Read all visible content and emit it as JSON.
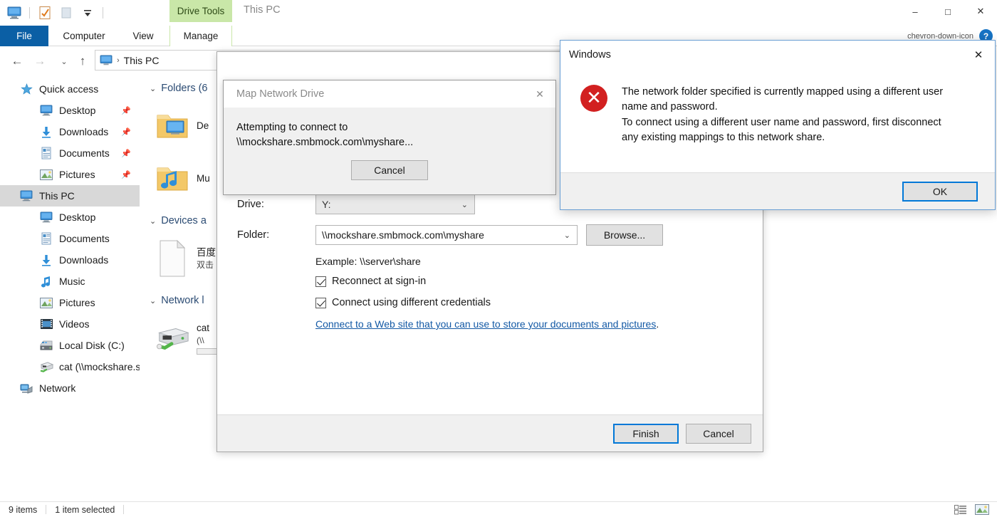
{
  "window": {
    "title": "This PC",
    "contextual_tab": "Drive Tools",
    "minimize": "–",
    "maximize": "□",
    "close": "✕"
  },
  "quick_access_toolbar": {
    "icons": [
      "this-pc-icon",
      "properties-icon",
      "new-folder-icon",
      "customize-dropdown-icon"
    ]
  },
  "ribbon": {
    "tabs": [
      {
        "label": "File"
      },
      {
        "label": "Computer"
      },
      {
        "label": "View"
      },
      {
        "label": "Manage"
      }
    ],
    "collapse_icon": "chevron-down-icon",
    "help_icon": "?"
  },
  "navbar": {
    "back": "←",
    "forward": "→",
    "recent": "⌄",
    "up": "↑",
    "breadcrumb": {
      "separator": "›",
      "path": "This PC"
    }
  },
  "sidebar": {
    "items": [
      {
        "label": "Quick access",
        "icon": "star-icon",
        "level": 0,
        "pinned": false,
        "selected": false
      },
      {
        "label": "Desktop",
        "icon": "desktop-icon",
        "level": 1,
        "pinned": true,
        "selected": false
      },
      {
        "label": "Downloads",
        "icon": "download-icon",
        "level": 1,
        "pinned": true,
        "selected": false
      },
      {
        "label": "Documents",
        "icon": "documents-icon",
        "level": 1,
        "pinned": true,
        "selected": false
      },
      {
        "label": "Pictures",
        "icon": "pictures-icon",
        "level": 1,
        "pinned": true,
        "selected": false
      },
      {
        "label": "This PC",
        "icon": "this-pc-icon",
        "level": 0,
        "pinned": false,
        "selected": true
      },
      {
        "label": "Desktop",
        "icon": "desktop-icon",
        "level": 1,
        "pinned": false,
        "selected": false
      },
      {
        "label": "Documents",
        "icon": "documents-icon",
        "level": 1,
        "pinned": false,
        "selected": false
      },
      {
        "label": "Downloads",
        "icon": "download-icon",
        "level": 1,
        "pinned": false,
        "selected": false
      },
      {
        "label": "Music",
        "icon": "music-icon",
        "level": 1,
        "pinned": false,
        "selected": false
      },
      {
        "label": "Pictures",
        "icon": "pictures-icon",
        "level": 1,
        "pinned": false,
        "selected": false
      },
      {
        "label": "Videos",
        "icon": "videos-icon",
        "level": 1,
        "pinned": false,
        "selected": false
      },
      {
        "label": "Local Disk (C:)",
        "icon": "hard-drive-icon",
        "level": 1,
        "pinned": false,
        "selected": false
      },
      {
        "label": "cat (\\\\mockshare.sr",
        "icon": "network-drive-icon",
        "level": 1,
        "pinned": false,
        "selected": false
      },
      {
        "label": "Network",
        "icon": "network-icon",
        "level": 0,
        "pinned": false,
        "selected": false
      }
    ]
  },
  "content": {
    "groups": [
      {
        "header": "Folders (6",
        "chevron": "⌄"
      },
      {
        "header": "Devices a",
        "chevron": "⌄"
      },
      {
        "header": "Network l",
        "chevron": "⌄"
      }
    ],
    "folder_items": [
      {
        "name": "De",
        "icon": "desktop-folder-icon"
      },
      {
        "name": "Mu",
        "icon": "music-folder-icon"
      }
    ],
    "device_items": [
      {
        "name": "百度",
        "sub": "双击",
        "icon": "generic-file-icon"
      }
    ],
    "network_items": [
      {
        "name": "cat",
        "sub": "(\\\\",
        "icon": "network-drive-icon"
      }
    ]
  },
  "statusbar": {
    "item_count": "9 items",
    "selection": "1 item selected",
    "view_details_icon": "details-view-icon",
    "view_large_icon": "large-icons-view-icon"
  },
  "wizard": {
    "drive_label": "Drive:",
    "drive_value": "Y:",
    "folder_label": "Folder:",
    "folder_value": "\\\\mockshare.smbmock.com\\myshare",
    "browse_label": "Browse...",
    "example_text": "Example: \\\\server\\share",
    "reconnect_label": "Reconnect at sign-in",
    "reconnect_checked": true,
    "credentials_label": "Connect using different credentials",
    "credentials_checked": true,
    "web_link": "Connect to a Web site that you can use to store your documents and pictures",
    "web_link_period": ".",
    "finish_label": "Finish",
    "cancel_label": "Cancel",
    "dropdown_icon": "⌄"
  },
  "progress_dialog": {
    "title": "Map Network Drive",
    "close_icon": "✕",
    "message_line1": "Attempting to connect to",
    "message_line2": "\\\\mockshare.smbmock.com\\myshare...",
    "cancel_label": "Cancel"
  },
  "error_dialog": {
    "title": "Windows",
    "close_icon": "✕",
    "icon": "error-icon",
    "message_line1": "The network folder specified is currently mapped using a different user",
    "message_line2": "name and password.",
    "message_line3": "To connect using a different user name and password, first disconnect",
    "message_line4": "any existing mappings to this network share.",
    "ok_label": "OK"
  },
  "colors": {
    "file_tab_blue": "#0b5fa5",
    "contextual_green": "#c9e7a8",
    "error_red": "#d22020",
    "link_blue": "#1359a5",
    "focus_blue": "#0078d7"
  }
}
